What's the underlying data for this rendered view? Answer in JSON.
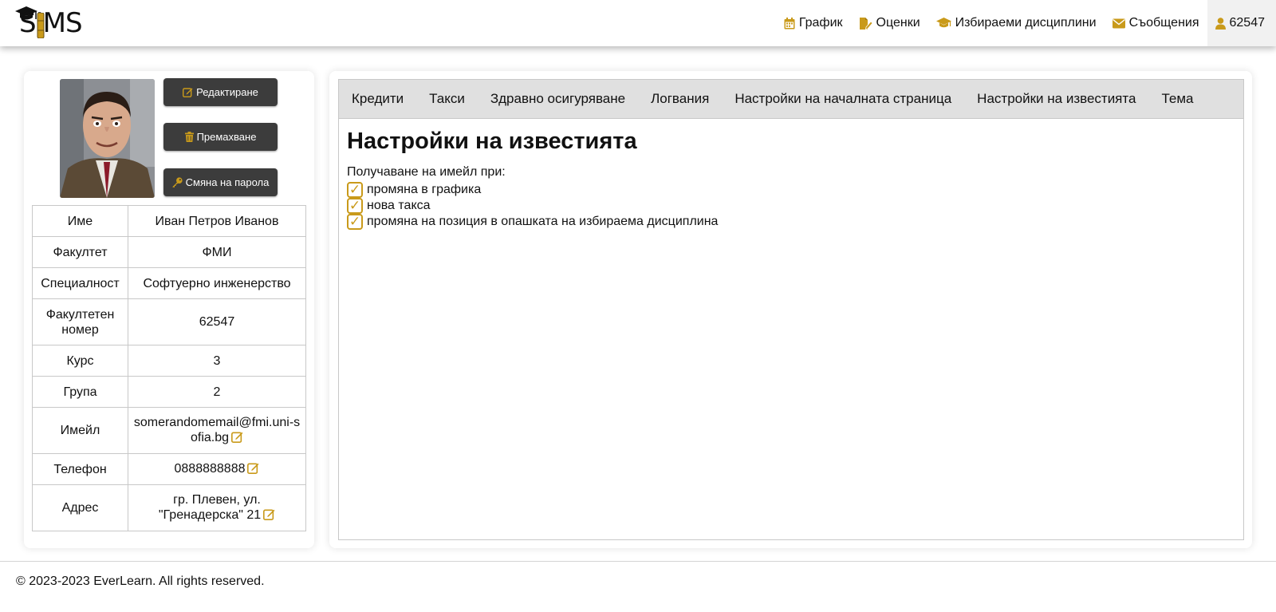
{
  "header": {
    "logo_text": "SIMS",
    "nav": [
      {
        "label": "График",
        "icon": "calendar-icon"
      },
      {
        "label": "Оценки",
        "icon": "file-edit-icon"
      },
      {
        "label": "Избираеми дисциплини",
        "icon": "graduation-cap-icon"
      },
      {
        "label": "Съобщения",
        "icon": "envelope-icon"
      },
      {
        "label": "62547",
        "icon": "user-icon"
      }
    ]
  },
  "profile": {
    "buttons": {
      "edit": "Редактиране",
      "remove": "Премахване",
      "change_password": "Смяна на парола"
    },
    "rows": [
      {
        "key": "Име",
        "value": "Иван Петров Иванов"
      },
      {
        "key": "Факултет",
        "value": "ФМИ"
      },
      {
        "key": "Специалност",
        "value": "Софтуерно инженерство"
      },
      {
        "key": "Факултетен номер",
        "value": "62547"
      },
      {
        "key": "Курс",
        "value": "3"
      },
      {
        "key": "Група",
        "value": "2"
      },
      {
        "key": "Имейл",
        "value": "somerandomemail@fmi.uni-sofia.bg"
      },
      {
        "key": "Телефон",
        "value": "0888888888"
      },
      {
        "key": "Адрес",
        "value": "гр. Плевен, ул. \"Гренадерска\" 21"
      }
    ]
  },
  "settings": {
    "tabs": [
      "Кредити",
      "Такси",
      "Здравно осигуряване",
      "Логвания",
      "Настройки на началната страница",
      "Настройки на известията",
      "Тема"
    ],
    "title": "Настройки на известията",
    "lead": "Получаване на имейл при:",
    "options": [
      {
        "label": "промяна в графика",
        "checked": true
      },
      {
        "label": "нова такса",
        "checked": true
      },
      {
        "label": "промяна на позиция в опашката на избираема дисциплина",
        "checked": true
      }
    ],
    "check_glyph": "✓"
  },
  "footer": {
    "text": "© 2023-2023 EverLearn. All rights reserved."
  },
  "colors": {
    "accent": "#c99a1a",
    "button_dark": "#3c3c3c",
    "tab_bar": "#e0e0e0"
  }
}
